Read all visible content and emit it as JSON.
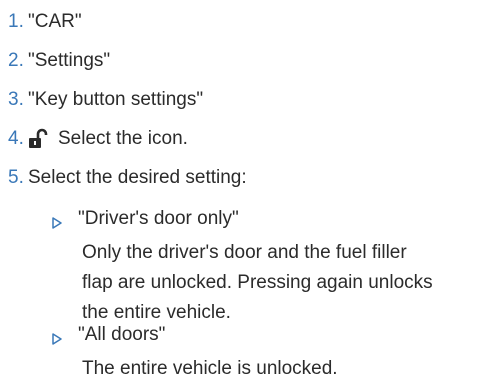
{
  "steps": [
    {
      "number": "1.",
      "text": "\"CAR\""
    },
    {
      "number": "2.",
      "text": "\"Settings\""
    },
    {
      "number": "3.",
      "text": "\"Key button settings\""
    },
    {
      "number": "4.",
      "text": "Select the icon.",
      "icon": "unlock-icon"
    },
    {
      "number": "5.",
      "text": "Select the desired setting:"
    }
  ],
  "options": [
    {
      "label": "\"Driver's door only\"",
      "description_lines": [
        "Only the driver's door and the fuel filler",
        "flap are unlocked. Pressing again unlocks",
        "the entire vehicle."
      ]
    },
    {
      "label": "\"All doors\"",
      "description_lines": [
        "The entire vehicle is unlocked."
      ]
    }
  ],
  "colors": {
    "accent": "#3a78b8",
    "text": "#2b2b2b"
  }
}
